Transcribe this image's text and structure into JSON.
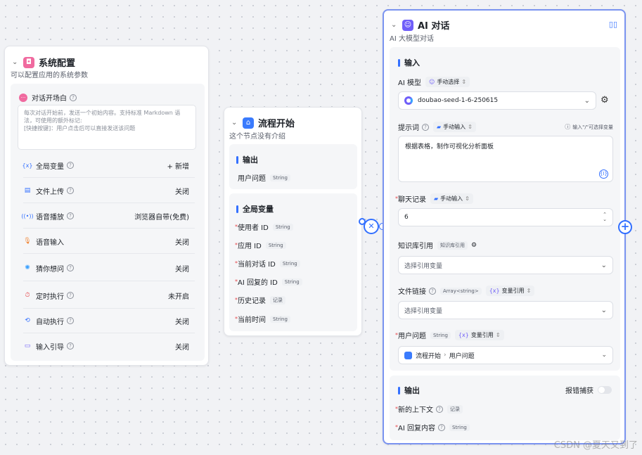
{
  "sys_config": {
    "title": "系统配置",
    "desc": "可以配置应用的系统参数",
    "opening": {
      "label": "对话开场白",
      "text": "每次对话开始前，发送一个初始内容。支持标准 Markdown 语法，可使用的额外标记:\n[快捷按键]：用户点击后可以直接发送该问题"
    },
    "rows": [
      {
        "label": "全局变量",
        "value": "+ 新增",
        "icon": "variable-icon"
      },
      {
        "label": "文件上传",
        "value": "关闭",
        "icon": "file-upload-icon"
      },
      {
        "label": "语音播放",
        "value": "浏览器自带(免费)",
        "icon": "speaker-icon"
      },
      {
        "label": "语音输入",
        "value": "关闭",
        "icon": "microphone-icon"
      },
      {
        "label": "猜你想问",
        "value": "关闭",
        "icon": "lightbulb-icon"
      },
      {
        "label": "定时执行",
        "value": "未开启",
        "icon": "timer-icon"
      },
      {
        "label": "自动执行",
        "value": "关闭",
        "icon": "auto-run-icon"
      },
      {
        "label": "输入引导",
        "value": "关闭",
        "icon": "input-guide-icon"
      }
    ]
  },
  "flow_start": {
    "title": "流程开始",
    "desc": "这个节点没有介绍",
    "output": {
      "title": "输出",
      "items": [
        {
          "label": "用户问题",
          "type": "String"
        }
      ]
    },
    "globals": {
      "title": "全局变量",
      "items": [
        {
          "label": "使用者 ID",
          "type": "String"
        },
        {
          "label": "应用 ID",
          "type": "String"
        },
        {
          "label": "当前对话 ID",
          "type": "String"
        },
        {
          "label": "AI 回复的 ID",
          "type": "String"
        },
        {
          "label": "历史记录",
          "type": "记录"
        },
        {
          "label": "当前时间",
          "type": "String"
        }
      ]
    }
  },
  "ai_chat": {
    "title": "AI 对话",
    "desc": "AI 大模型对话",
    "input_title": "输入",
    "model": {
      "label": "AI 模型",
      "mode": "手动选择",
      "value": "doubao-seed-1-6-250615"
    },
    "prompt": {
      "label": "提示词",
      "mode": "手动输入",
      "hint": "输入\"/\"可选择变量",
      "value": "根据表格，制作可视化分析面板"
    },
    "history": {
      "label": "聊天记录",
      "mode": "手动输入",
      "value": "6"
    },
    "knowledge": {
      "label": "知识库引用",
      "tag": "知识库引用",
      "placeholder": "选择引用变量"
    },
    "file_link": {
      "label": "文件链接",
      "type": "Array<string>",
      "mode": "变量引用",
      "placeholder": "选择引用变量"
    },
    "user_question": {
      "label": "用户问题",
      "type": "String",
      "mode": "变量引用",
      "value_node": "流程开始",
      "value_field": "用户问题"
    },
    "output": {
      "title": "输出",
      "error_catch": "报错捕获",
      "items": [
        {
          "label": "新的上下文",
          "type": "记录"
        },
        {
          "label": "AI 回复内容",
          "type": "String"
        }
      ]
    }
  },
  "watermark": "CSDN @夏天又到了",
  "colors": {
    "accent": "#3370ff",
    "sys_icon": "#f06a9f",
    "flow_icon": "#3a7bfd",
    "ai_icon": "#6f5ef9"
  }
}
